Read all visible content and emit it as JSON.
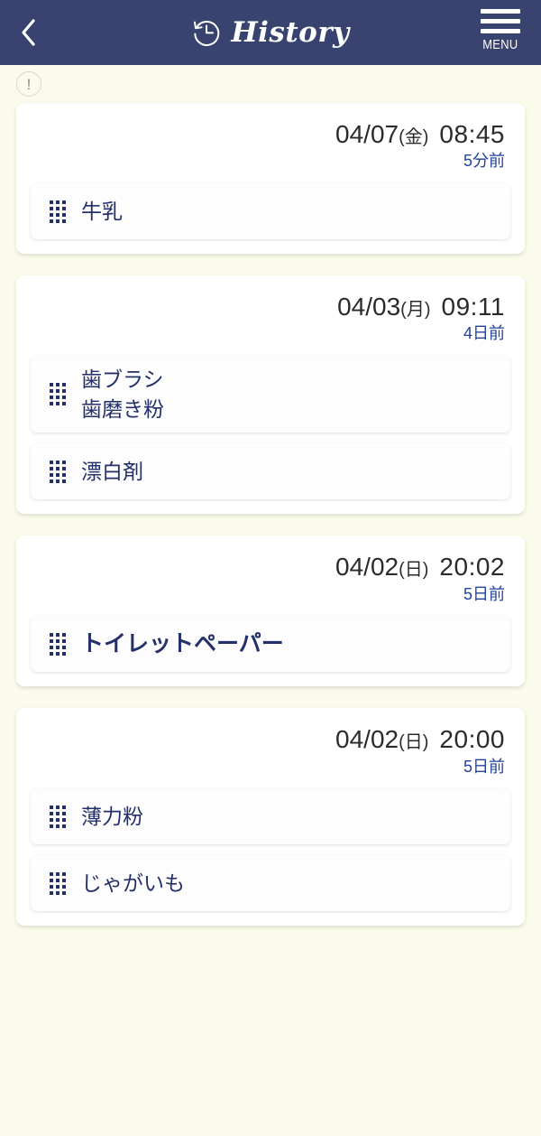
{
  "theme": {
    "header_bg": "#38436f",
    "page_bg": "#fbfbec",
    "card_bg": "#ffffff",
    "item_text": "#24306b",
    "relative_text": "#23439b",
    "datetime_text": "#2b2b2b"
  },
  "header": {
    "back_label": "‹",
    "title": "History",
    "history_icon": "clock-rewind-icon",
    "menu_label": "MENU"
  },
  "alert": {
    "icon": "exclamation-circle-icon",
    "symbol": "!"
  },
  "history": [
    {
      "date": "04/07",
      "weekday": "(金)",
      "time": "08:45",
      "relative": "5分前",
      "items": [
        {
          "lines": [
            "牛乳"
          ],
          "emphasis": false
        }
      ]
    },
    {
      "date": "04/03",
      "weekday": "(月)",
      "time": "09:11",
      "relative": "4日前",
      "items": [
        {
          "lines": [
            "歯ブラシ",
            "歯磨き粉"
          ],
          "emphasis": false
        },
        {
          "lines": [
            "漂白剤"
          ],
          "emphasis": false
        }
      ]
    },
    {
      "date": "04/02",
      "weekday": "(日)",
      "time": "20:02",
      "relative": "5日前",
      "items": [
        {
          "lines": [
            "トイレットペーパー"
          ],
          "emphasis": true
        }
      ]
    },
    {
      "date": "04/02",
      "weekday": "(日)",
      "time": "20:00",
      "relative": "5日前",
      "items": [
        {
          "lines": [
            "薄力粉"
          ],
          "emphasis": false
        },
        {
          "lines": [
            "じゃがいも"
          ],
          "emphasis": false
        }
      ]
    }
  ]
}
